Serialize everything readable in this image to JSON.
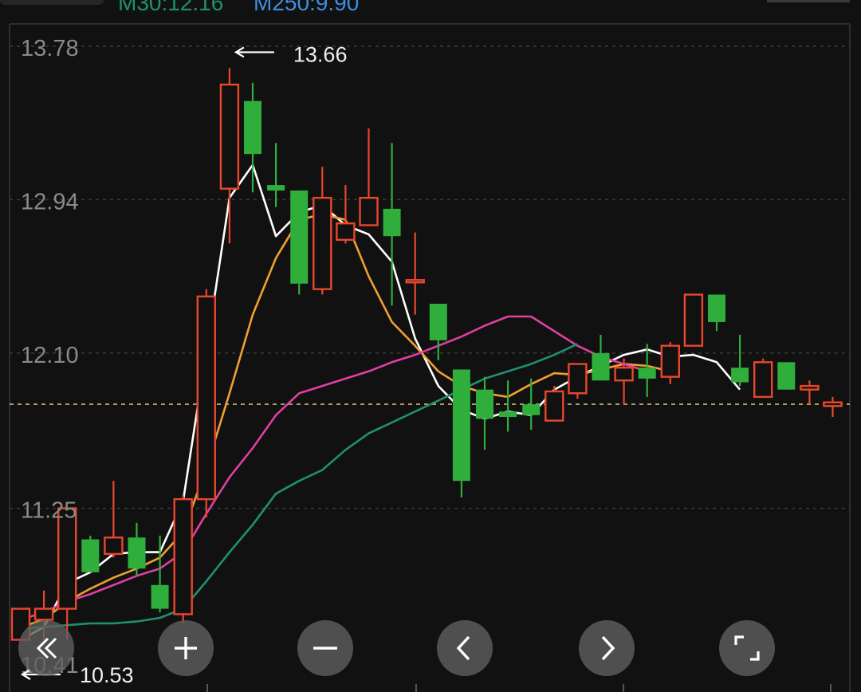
{
  "header": {
    "ma30_label": "M30:12.16",
    "ma250_label": "M250:9.90"
  },
  "chart_data": {
    "type": "candlestick",
    "y_ticks": [
      "13.78",
      "12.94",
      "12.10",
      "11.25"
    ],
    "partial_y_tick": "10.41",
    "ylim": [
      10.41,
      13.78
    ],
    "max_annotation": "13.66",
    "min_annotation": "10.53",
    "reference_price": 11.82,
    "candles": [
      {
        "o": 10.53,
        "h": 10.68,
        "l": 10.53,
        "c": 10.7
      },
      {
        "o": 10.64,
        "h": 10.8,
        "l": 10.53,
        "c": 10.7
      },
      {
        "o": 10.7,
        "h": 11.25,
        "l": 10.53,
        "c": 11.25
      },
      {
        "o": 11.08,
        "h": 11.1,
        "l": 10.95,
        "c": 10.9
      },
      {
        "o": 11.0,
        "h": 11.4,
        "l": 10.98,
        "c": 11.09
      },
      {
        "o": 11.09,
        "h": 11.17,
        "l": 10.88,
        "c": 10.92
      },
      {
        "o": 10.83,
        "h": 11.1,
        "l": 10.68,
        "c": 10.7
      },
      {
        "o": 10.67,
        "h": 11.32,
        "l": 10.62,
        "c": 11.3
      },
      {
        "o": 11.3,
        "h": 12.45,
        "l": 11.2,
        "c": 12.41
      },
      {
        "o": 13.0,
        "h": 13.66,
        "l": 12.7,
        "c": 13.57
      },
      {
        "o": 13.48,
        "h": 13.58,
        "l": 12.98,
        "c": 13.19
      },
      {
        "o": 13.02,
        "h": 13.25,
        "l": 12.9,
        "c": 12.99
      },
      {
        "o": 12.99,
        "h": 12.99,
        "l": 12.42,
        "c": 12.48
      },
      {
        "o": 12.45,
        "h": 13.12,
        "l": 12.42,
        "c": 12.95
      },
      {
        "o": 12.72,
        "h": 13.02,
        "l": 12.7,
        "c": 12.81
      },
      {
        "o": 12.8,
        "h": 13.33,
        "l": 12.8,
        "c": 12.95
      },
      {
        "o": 12.89,
        "h": 13.25,
        "l": 12.36,
        "c": 12.74
      },
      {
        "o": 12.5,
        "h": 12.76,
        "l": 12.31,
        "c": 12.5
      },
      {
        "o": 12.37,
        "h": 12.37,
        "l": 12.06,
        "c": 12.17
      },
      {
        "o": 12.01,
        "h": 12.01,
        "l": 11.31,
        "c": 11.4
      },
      {
        "o": 11.9,
        "h": 11.97,
        "l": 11.57,
        "c": 11.74
      },
      {
        "o": 11.78,
        "h": 11.95,
        "l": 11.67,
        "c": 11.75
      },
      {
        "o": 11.82,
        "h": 11.96,
        "l": 11.68,
        "c": 11.76
      },
      {
        "o": 11.73,
        "h": 11.92,
        "l": 11.73,
        "c": 11.89
      },
      {
        "o": 11.88,
        "h": 12.04,
        "l": 11.85,
        "c": 12.04
      },
      {
        "o": 12.1,
        "h": 12.2,
        "l": 11.96,
        "c": 11.95
      },
      {
        "o": 11.95,
        "h": 12.07,
        "l": 11.82,
        "c": 12.02
      },
      {
        "o": 12.02,
        "h": 12.15,
        "l": 11.86,
        "c": 11.96
      },
      {
        "o": 11.97,
        "h": 12.16,
        "l": 11.93,
        "c": 12.14
      },
      {
        "o": 12.14,
        "h": 12.38,
        "l": 12.14,
        "c": 12.42
      },
      {
        "o": 12.42,
        "h": 12.42,
        "l": 12.22,
        "c": 12.27
      },
      {
        "o": 12.02,
        "h": 12.2,
        "l": 11.92,
        "c": 11.94
      },
      {
        "o": 11.86,
        "h": 12.07,
        "l": 11.87,
        "c": 12.05
      },
      {
        "o": 12.05,
        "h": 12.05,
        "l": 11.95,
        "c": 11.9
      },
      {
        "o": 11.9,
        "h": 11.95,
        "l": 11.82,
        "c": 11.92
      },
      {
        "o": 11.81,
        "h": 11.86,
        "l": 11.75,
        "c": 11.83
      }
    ],
    "series": [
      {
        "color": "#ffffff",
        "values": [
          10.53,
          10.6,
          10.84,
          10.9,
          11.0,
          11.01,
          11.01,
          11.29,
          12.11,
          12.95,
          13.13,
          12.74,
          12.87,
          12.91,
          12.8,
          12.75,
          12.6,
          12.18,
          11.92,
          11.79,
          11.74,
          11.78,
          11.76,
          11.9,
          11.97,
          12.03,
          12.09,
          12.12,
          12.08,
          12.09,
          12.05,
          11.9
        ]
      },
      {
        "color": "#f0a030",
        "values": [
          10.6,
          10.64,
          10.74,
          10.81,
          10.87,
          10.92,
          10.98,
          11.12,
          11.47,
          11.88,
          12.31,
          12.62,
          12.83,
          12.86,
          12.83,
          12.52,
          12.27,
          12.14,
          12.0,
          11.92,
          11.88,
          11.86,
          11.93,
          11.99,
          11.98,
          12.01,
          12.04,
          12.03,
          12.0
        ]
      },
      {
        "color": "#e040a0",
        "values": [
          10.64,
          10.68,
          10.74,
          10.78,
          10.83,
          10.88,
          10.92,
          11.01,
          11.22,
          11.42,
          11.58,
          11.76,
          11.88,
          11.92,
          11.96,
          12.0,
          12.05,
          12.09,
          12.14,
          12.19,
          12.25,
          12.3,
          12.3,
          12.22,
          12.14,
          12.08,
          12.04,
          12.0
        ]
      },
      {
        "color": "#1e9070",
        "values": [
          10.59,
          10.6,
          10.61,
          10.62,
          10.62,
          10.63,
          10.65,
          10.7,
          10.85,
          11.01,
          11.16,
          11.33,
          11.4,
          11.46,
          11.57,
          11.66,
          11.72,
          11.78,
          11.84,
          11.9,
          11.96,
          12.0,
          12.04,
          12.09,
          12.15
        ]
      }
    ]
  },
  "controls": [
    {
      "name": "scroll-left-button",
      "icon": "double-chevron-left-icon"
    },
    {
      "name": "zoom-in-button",
      "icon": "plus-icon"
    },
    {
      "name": "zoom-out-button",
      "icon": "minus-icon"
    },
    {
      "name": "prev-button",
      "icon": "chevron-left-icon"
    },
    {
      "name": "next-button",
      "icon": "chevron-right-icon"
    },
    {
      "name": "fullscreen-button",
      "icon": "fullscreen-icon"
    }
  ],
  "colors": {
    "up": "#e8472c",
    "down": "#2fae3c",
    "ma30_text": "#1e9070",
    "ma250_text": "#3d8fe0",
    "reference_line": "#e8c87a"
  }
}
